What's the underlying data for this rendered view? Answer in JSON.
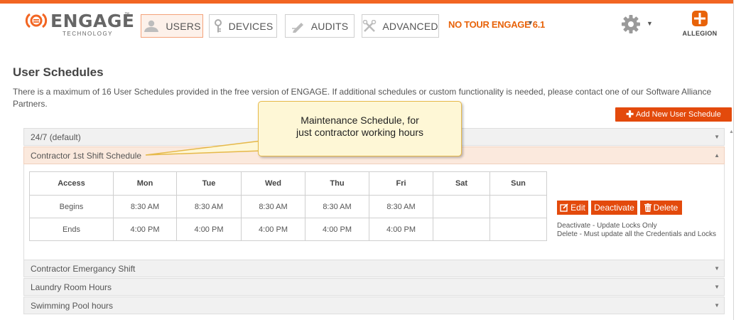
{
  "header": {
    "logo": {
      "brand": "ENGAGE",
      "tagline": "TECHNOLOGY",
      "tm": "™"
    },
    "nav": [
      {
        "label": "USERS",
        "icon": "user-icon",
        "active": true
      },
      {
        "label": "DEVICES",
        "icon": "key-icon",
        "active": false
      },
      {
        "label": "AUDITS",
        "icon": "pencil-icon",
        "active": false
      },
      {
        "label": "ADVANCED",
        "icon": "tools-icon",
        "active": false
      }
    ],
    "site_selector": "NO TOUR ENGAGE 6.1",
    "caret": "▼",
    "settings_icon": "gear-icon",
    "partner_logo": "ALLEGION"
  },
  "page": {
    "title": "User Schedules",
    "info": "There is a maximum of 16 User Schedules provided in the free version of ENGAGE. If additional schedules or custom functionality is needed, please contact one of our Software Alliance Partners.",
    "add_button": "Add New User Schedule"
  },
  "schedules": [
    {
      "name": "24/7 (default)",
      "expanded": false
    },
    {
      "name": "Contractor 1st Shift Schedule",
      "expanded": true
    },
    {
      "name": "Contractor Emergancy Shift",
      "expanded": false
    },
    {
      "name": "Laundry Room Hours",
      "expanded": false
    },
    {
      "name": "Swimming Pool hours",
      "expanded": false
    }
  ],
  "expanded_schedule": {
    "headers": [
      "Access",
      "Mon",
      "Tue",
      "Wed",
      "Thu",
      "Fri",
      "Sat",
      "Sun"
    ],
    "rows": [
      [
        "Begins",
        "8:30 AM",
        "8:30 AM",
        "8:30 AM",
        "8:30 AM",
        "8:30 AM",
        "",
        ""
      ],
      [
        "Ends",
        "4:00 PM",
        "4:00 PM",
        "4:00 PM",
        "4:00 PM",
        "4:00 PM",
        "",
        ""
      ]
    ],
    "actions": {
      "edit": "Edit",
      "deactivate": "Deactivate",
      "delete": "Delete"
    },
    "help": {
      "deactivate": "Deactivate - Update Locks Only",
      "delete": "Delete - Must update all the Credentials and Locks"
    }
  },
  "callout": {
    "line1": "Maintenance Schedule, for",
    "line2": "just contractor working hours"
  },
  "colors": {
    "accent": "#e34a0c",
    "brand_orange": "#f26522",
    "callout_bg": "#fef7d6"
  }
}
